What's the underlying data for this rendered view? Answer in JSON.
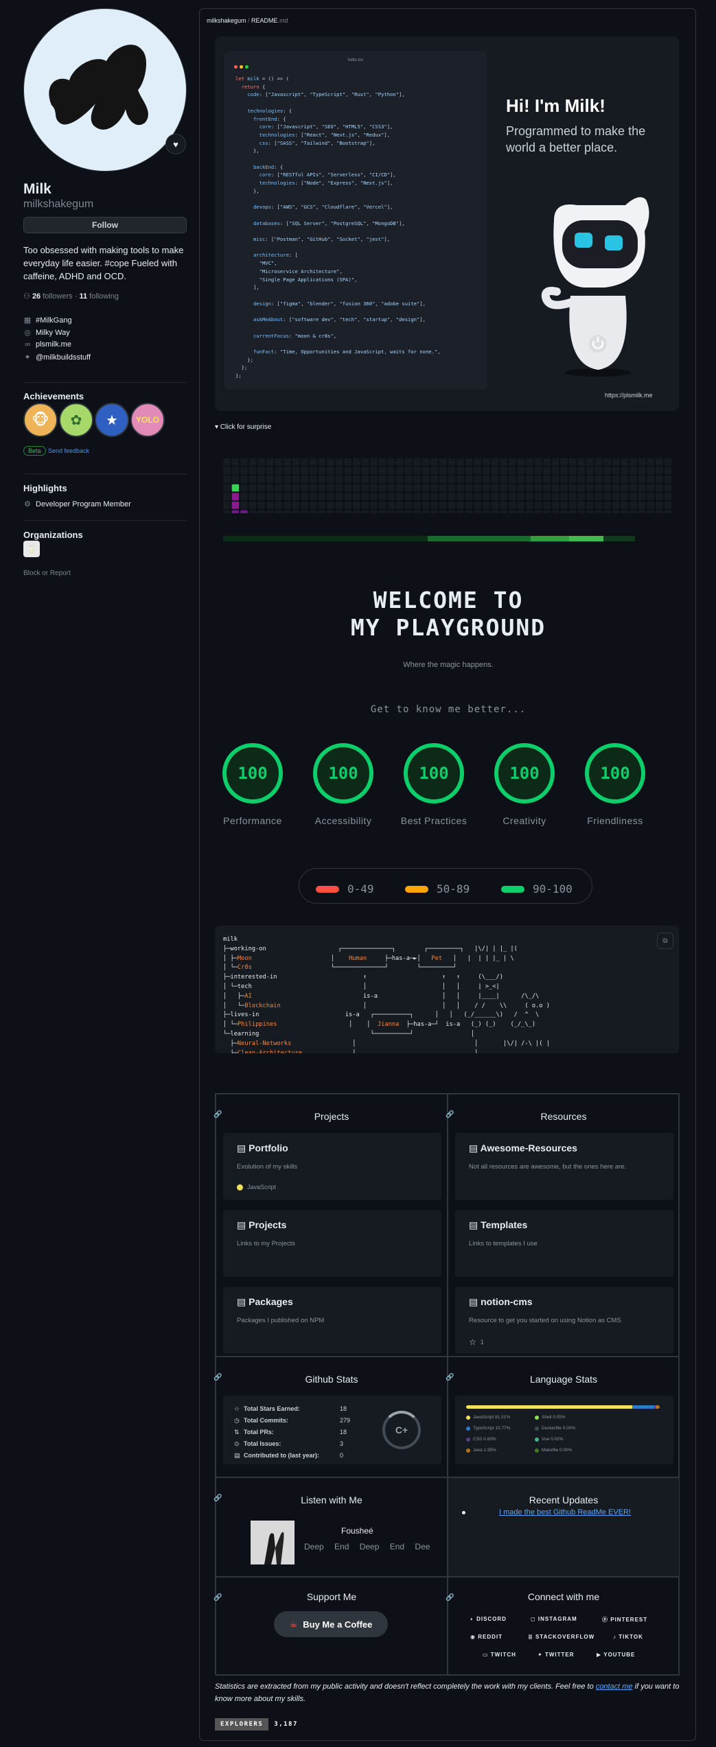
{
  "profile": {
    "display_name": "Milk",
    "login": "milkshakegum",
    "follow_label": "Follow",
    "bio": "Too obsessed with making tools to make everyday life easier. #cope Fueled with caffeine, ADHD and OCD.",
    "followers_count": "26",
    "followers_label": "followers",
    "following_count": "11",
    "following_label": "following",
    "org": "#MilkGang",
    "location": "Milky Way",
    "website": "plsmilk.me",
    "twitter": "@milkbuildsstuff",
    "achievements_title": "Achievements",
    "achievements": [
      {
        "name": "pull-shark",
        "color": "#f0b458"
      },
      {
        "name": "quickdraw",
        "color": "#a7d96a"
      },
      {
        "name": "starstruck",
        "color": "#2f5fc0"
      },
      {
        "name": "yolo",
        "color": "#e28ab8"
      }
    ],
    "yolo_text": "YOLO",
    "beta_label": "Beta",
    "feedback_label": "Send feedback",
    "highlights_title": "Highlights",
    "highlight_item": "Developer Program Member",
    "organizations_title": "Organizations",
    "block_label": "Block or Report"
  },
  "readme": {
    "crumb_user": "milkshakegum",
    "crumb_sep": " / ",
    "crumb_file": "README",
    "crumb_ext": ".md",
    "editor_title": "hello.tsx",
    "hero_title": "Hi! I'm Milk!",
    "hero_subtitle": "Programmed to make the world a better place.",
    "hero_url": "https://plsmilk.me",
    "surprise_label": "▾ Click for surprise",
    "welcome_line1": "WELCOME TO",
    "welcome_line2": "MY PLAYGROUND",
    "welcome_sub": "Where the magic happens.",
    "know_me": "Get to know me better...",
    "scores": [
      {
        "value": "100",
        "label": "Performance"
      },
      {
        "value": "100",
        "label": "Accessibility"
      },
      {
        "value": "100",
        "label": "Best Practices"
      },
      {
        "value": "100",
        "label": "Creativity"
      },
      {
        "value": "100",
        "label": "Friendliness"
      }
    ],
    "legend": [
      {
        "label": "0-49",
        "color": "#ff4e42"
      },
      {
        "label": "50-89",
        "color": "#ffa400"
      },
      {
        "label": "90-100",
        "color": "#0cce6b"
      }
    ]
  },
  "sections": {
    "projects_title": "Projects",
    "resources_title": "Resources",
    "repos_left": [
      {
        "name": "Portfolio",
        "desc": "Evolution of my skills",
        "lang": "JavaScript",
        "lang_color": "#f1e05a"
      },
      {
        "name": "Projects",
        "desc": "Links to my Projects"
      },
      {
        "name": "Packages",
        "desc": "Packages I published on NPM"
      }
    ],
    "repos_right": [
      {
        "name": "Awesome-Resources",
        "desc": "Not all resources are awesome, but the ones here are."
      },
      {
        "name": "Templates",
        "desc": "Links to templates I use"
      },
      {
        "name": "notion-cms",
        "desc": "Resource to get you started on using Notion as CMS",
        "stars": "1"
      }
    ],
    "github_stats_title": "Github Stats",
    "language_stats_title": "Language Stats",
    "stats": [
      {
        "k": "Total Stars Earned:",
        "v": "18"
      },
      {
        "k": "Total Commits:",
        "v": "279"
      },
      {
        "k": "Total PRs:",
        "v": "18"
      },
      {
        "k": "Total Issues:",
        "v": "3"
      },
      {
        "k": "Contributed to (last year):",
        "v": "0"
      }
    ],
    "grade": "C+",
    "languages": [
      {
        "name": "JavaScript 81.51%",
        "color": "#f1e05a",
        "pct": 81.51
      },
      {
        "name": "TypeScript 10.77%",
        "color": "#3178c6",
        "pct": 10.77
      },
      {
        "name": "CSS 0.83%",
        "color": "#563d7c",
        "pct": 0.83
      },
      {
        "name": "Java 1.95%",
        "color": "#b07219",
        "pct": 1.95
      },
      {
        "name": "Shell 0.05%",
        "color": "#89e051",
        "pct": 0.05
      },
      {
        "name": "Dockerfile 0.00%",
        "color": "#384d54",
        "pct": 0.0
      },
      {
        "name": "Vue 0.02%",
        "color": "#41b883",
        "pct": 0.02
      },
      {
        "name": "Makefile 0.00%",
        "color": "#427819",
        "pct": 0.0
      }
    ],
    "listen_title": "Listen with Me",
    "song": "Fousheé",
    "artist_line": "Deep End Deep End Dee",
    "updates_title": "Recent Updates",
    "update_link": "I made the best Github ReadMe EVER!",
    "support_title": "Support Me",
    "coffee_label": "Buy Me a Coffee",
    "connect_title": "Connect with me",
    "socials": [
      "DISCORD",
      "INSTAGRAM",
      "PINTEREST",
      "REDDIT",
      "STACKOVERFLOW",
      "TIKTOK",
      "TWITCH",
      "TWITTER",
      "YOUTUBE"
    ],
    "footnote_pre": "Statistics are extracted from my public activity and doesn't reflect completely the work with my clients. Feel free to ",
    "footnote_link": "contact me",
    "footnote_post": " if you want to know more about my skills.",
    "explorers_label": "EXPLORERS",
    "explorers_count": "3,187"
  },
  "colors": {
    "accent": "#0cce6b",
    "link": "#58a6ff",
    "bg": "#0d1117"
  }
}
